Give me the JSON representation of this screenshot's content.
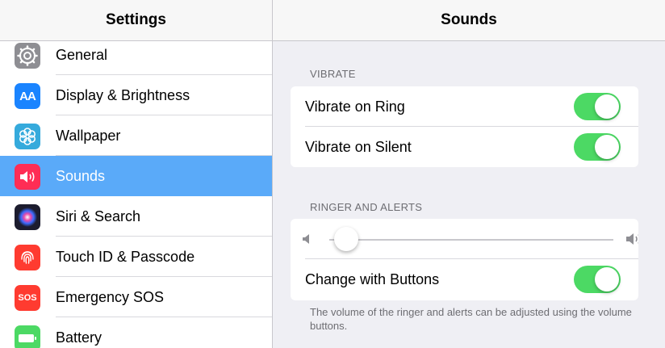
{
  "sidebar": {
    "title": "Settings",
    "items": [
      {
        "label": "General",
        "icon": "gear-icon",
        "color": "#8e8e93"
      },
      {
        "label": "Display & Brightness",
        "icon": "display-brightness-icon",
        "color": "#1a84ff"
      },
      {
        "label": "Wallpaper",
        "icon": "flower-icon",
        "color": "#35aadc"
      },
      {
        "label": "Sounds",
        "icon": "speaker-icon",
        "color": "#ff2d55",
        "selected": true
      },
      {
        "label": "Siri & Search",
        "icon": "siri-icon",
        "color": "#1c1c2e"
      },
      {
        "label": "Touch ID & Passcode",
        "icon": "fingerprint-icon",
        "color": "#ff3b30"
      },
      {
        "label": "Emergency SOS",
        "icon": "sos-icon",
        "color": "#ff3b30",
        "icon_text": "SOS"
      },
      {
        "label": "Battery",
        "icon": "battery-icon",
        "color": "#4cd964"
      }
    ],
    "icon_text_aa": "AA"
  },
  "detail": {
    "title": "Sounds",
    "vibrate": {
      "header": "VIBRATE",
      "rows": [
        {
          "label": "Vibrate on Ring",
          "on": true
        },
        {
          "label": "Vibrate on Silent",
          "on": true
        }
      ]
    },
    "ringer": {
      "header": "RINGER AND ALERTS",
      "volume_level": 0.02,
      "change_with_buttons": {
        "label": "Change with Buttons",
        "on": true
      },
      "footnote": "The volume of the ringer and alerts can be adjusted using the volume buttons."
    }
  },
  "colors": {
    "accent": "#5aaaf9",
    "toggle_on": "#4cd964"
  }
}
